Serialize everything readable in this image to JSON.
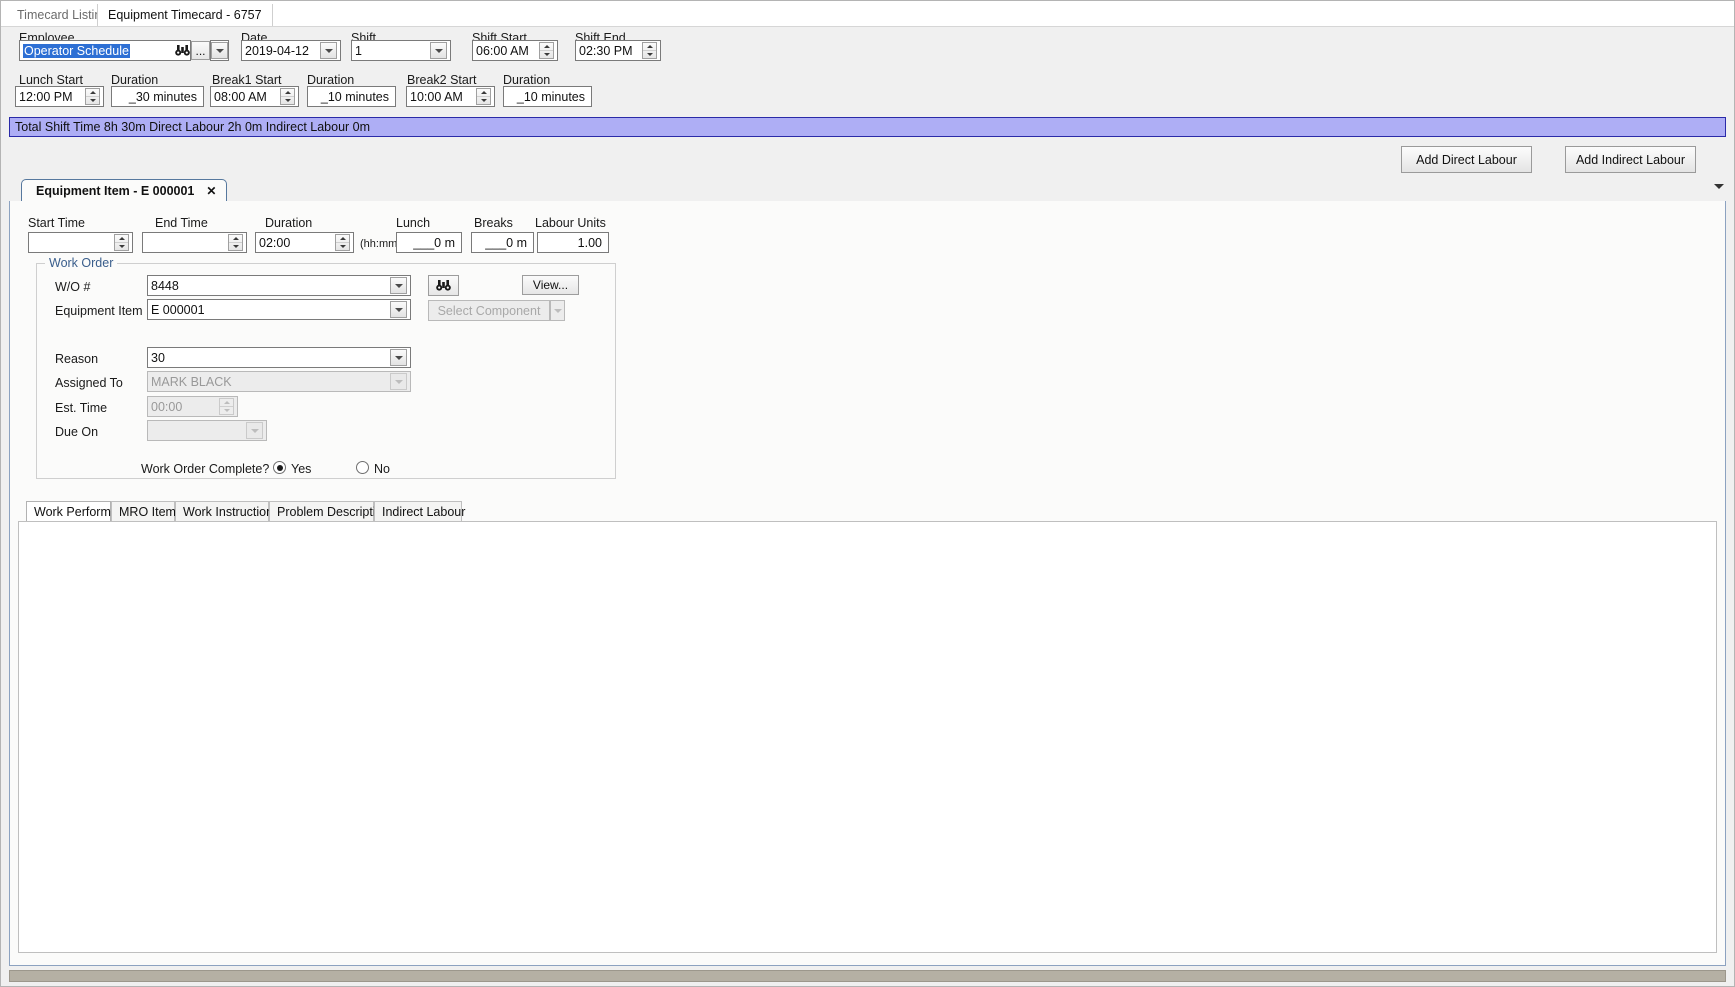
{
  "window": {
    "close_label": "✕"
  },
  "top_tabs": [
    {
      "label": "Timecard Listing",
      "active": false
    },
    {
      "label": "Equipment Timecard - 6757",
      "active": true
    }
  ],
  "header": {
    "employee": {
      "label": "Employee",
      "value": "Operator Schedule",
      "ellipsis_label": "...",
      "search_icon": "binoculars-icon"
    },
    "date": {
      "label": "Date",
      "value": "2019-04-12"
    },
    "shift": {
      "label": "Shift",
      "value": "1"
    },
    "shift_start": {
      "label": "Shift Start",
      "value": "06:00 AM"
    },
    "shift_end": {
      "label": "Shift End",
      "value": "02:30 PM"
    },
    "lunch_start": {
      "label": "Lunch Start",
      "value": "12:00 PM"
    },
    "lunch_duration": {
      "label": "Duration",
      "value": "_30 minutes"
    },
    "break1_start": {
      "label": "Break1 Start",
      "value": "08:00 AM"
    },
    "break1_duration": {
      "label": "Duration",
      "value": "_10 minutes"
    },
    "break2_start": {
      "label": "Break2 Start",
      "value": "10:00 AM"
    },
    "break2_duration": {
      "label": "Duration",
      "value": "_10 minutes"
    }
  },
  "summary": {
    "text": "Total Shift Time 8h 30m  Direct Labour 2h 0m  Indirect Labour 0m",
    "bg": "#aeaef5",
    "border": "#2a2aa8"
  },
  "actions": {
    "add_direct": "Add Direct Labour",
    "add_indirect": "Add Indirect Labour"
  },
  "inner_tab": {
    "label": "Equipment Item - E 000001",
    "close": "✕"
  },
  "labour": {
    "start_time": {
      "label": "Start Time",
      "value": ""
    },
    "end_time": {
      "label": "End Time",
      "value": ""
    },
    "duration": {
      "label": "Duration",
      "value": "02:00",
      "hint": "(hh:mm)"
    },
    "lunch": {
      "label": "Lunch",
      "value": "___0 m"
    },
    "breaks": {
      "label": "Breaks",
      "value": "___0 m"
    },
    "labour_units": {
      "label": "Labour Units",
      "value": "1.00"
    }
  },
  "work_order": {
    "legend": "Work Order",
    "wo_number": {
      "label": "W/O #",
      "value": "8448"
    },
    "search_icon": "binoculars-icon",
    "view_button": "View...",
    "equipment_item": {
      "label": "Equipment Item",
      "value": "E 000001"
    },
    "select_component": {
      "label": "Select Component"
    },
    "reason": {
      "label": "Reason",
      "value": "30"
    },
    "assigned_to": {
      "label": "Assigned To",
      "value": "MARK BLACK"
    },
    "est_time": {
      "label": "Est. Time",
      "value": "00:00"
    },
    "due_on": {
      "label": "Due On",
      "value": ""
    },
    "complete": {
      "label": "Work Order Complete?",
      "yes": "Yes",
      "no": "No",
      "selected": "yes"
    }
  },
  "bottom_tabs": [
    {
      "label": "Work Performed",
      "active": true
    },
    {
      "label": "MRO Items",
      "active": false
    },
    {
      "label": "Work Instructions",
      "active": false
    },
    {
      "label": "Problem Description",
      "active": false
    },
    {
      "label": "Indirect Labour",
      "active": false
    }
  ]
}
